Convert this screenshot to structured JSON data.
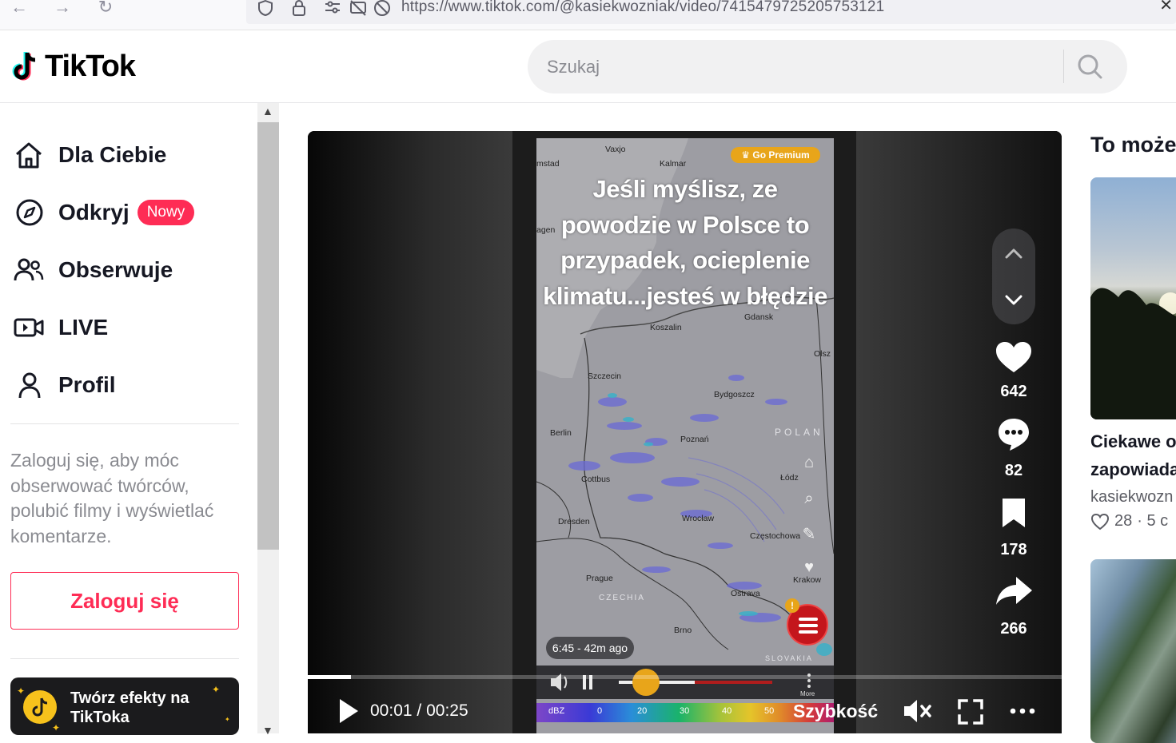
{
  "browser": {
    "url": "https://www.tiktok.com/@kasiekwozniak/video/7415479725205753121"
  },
  "header": {
    "logo_text": "TikTok",
    "search_placeholder": "Szukaj"
  },
  "sidebar": {
    "items": [
      {
        "label": "Dla Ciebie",
        "icon": "home-icon"
      },
      {
        "label": "Odkryj",
        "icon": "compass-icon",
        "badge": "Nowy"
      },
      {
        "label": "Obserwuje",
        "icon": "users-icon"
      },
      {
        "label": "LIVE",
        "icon": "live-camera-icon"
      },
      {
        "label": "Profil",
        "icon": "profile-icon"
      }
    ],
    "login_hint": "Zaloguj się, aby móc obserwować twórców, polubić filmy i wyświetlać komentarze.",
    "login_button": "Zaloguj się",
    "effects_banner": "Twórz efekty na TikToka"
  },
  "video": {
    "overlay_text": "Jeśli myślisz, ze powodzie w Polsce to przypadek, ocieplenie klimatu...jesteś w błędzie",
    "premium_badge": "♛ Go Premium",
    "map_time": "6:45 - 42m ago",
    "map_more": "More",
    "scale_unit": "dBZ",
    "scale_values": [
      "0",
      "20",
      "30",
      "40",
      "50"
    ],
    "cities": [
      "Vaxjo",
      "mstad",
      "Kalmar",
      "agen",
      "Gdansk",
      "Koszalin",
      "Olsz",
      "Szczecin",
      "Bydgoszcz",
      "Berlin",
      "Poznań",
      "Cottbus",
      "Łódz",
      "Dresden",
      "Wrocław",
      "Częstochowa",
      "Prague",
      "Ostrava",
      "Krakow",
      "Brno"
    ],
    "countries": [
      "POLAN",
      "CZECHIA",
      "SLOVAKIA"
    ],
    "progress": 0.057,
    "current_time": "00:01",
    "total_time": "00:25",
    "time_separator": "/",
    "speed_label": "Szybkość",
    "stats": {
      "likes": "642",
      "comments": "82",
      "saves": "178",
      "shares": "266"
    }
  },
  "right_rail": {
    "title": "To może",
    "card1_title_line1": "Ciekawe o",
    "card1_title_line2": "zapowiada",
    "card1_author": "kasiekwozn",
    "card1_likes": "28",
    "card1_meta": "· 5 c"
  },
  "colors": {
    "brand": "#fe2c55",
    "text": "#161823",
    "muted": "#8a8b91",
    "premium": "#e8a51a"
  }
}
